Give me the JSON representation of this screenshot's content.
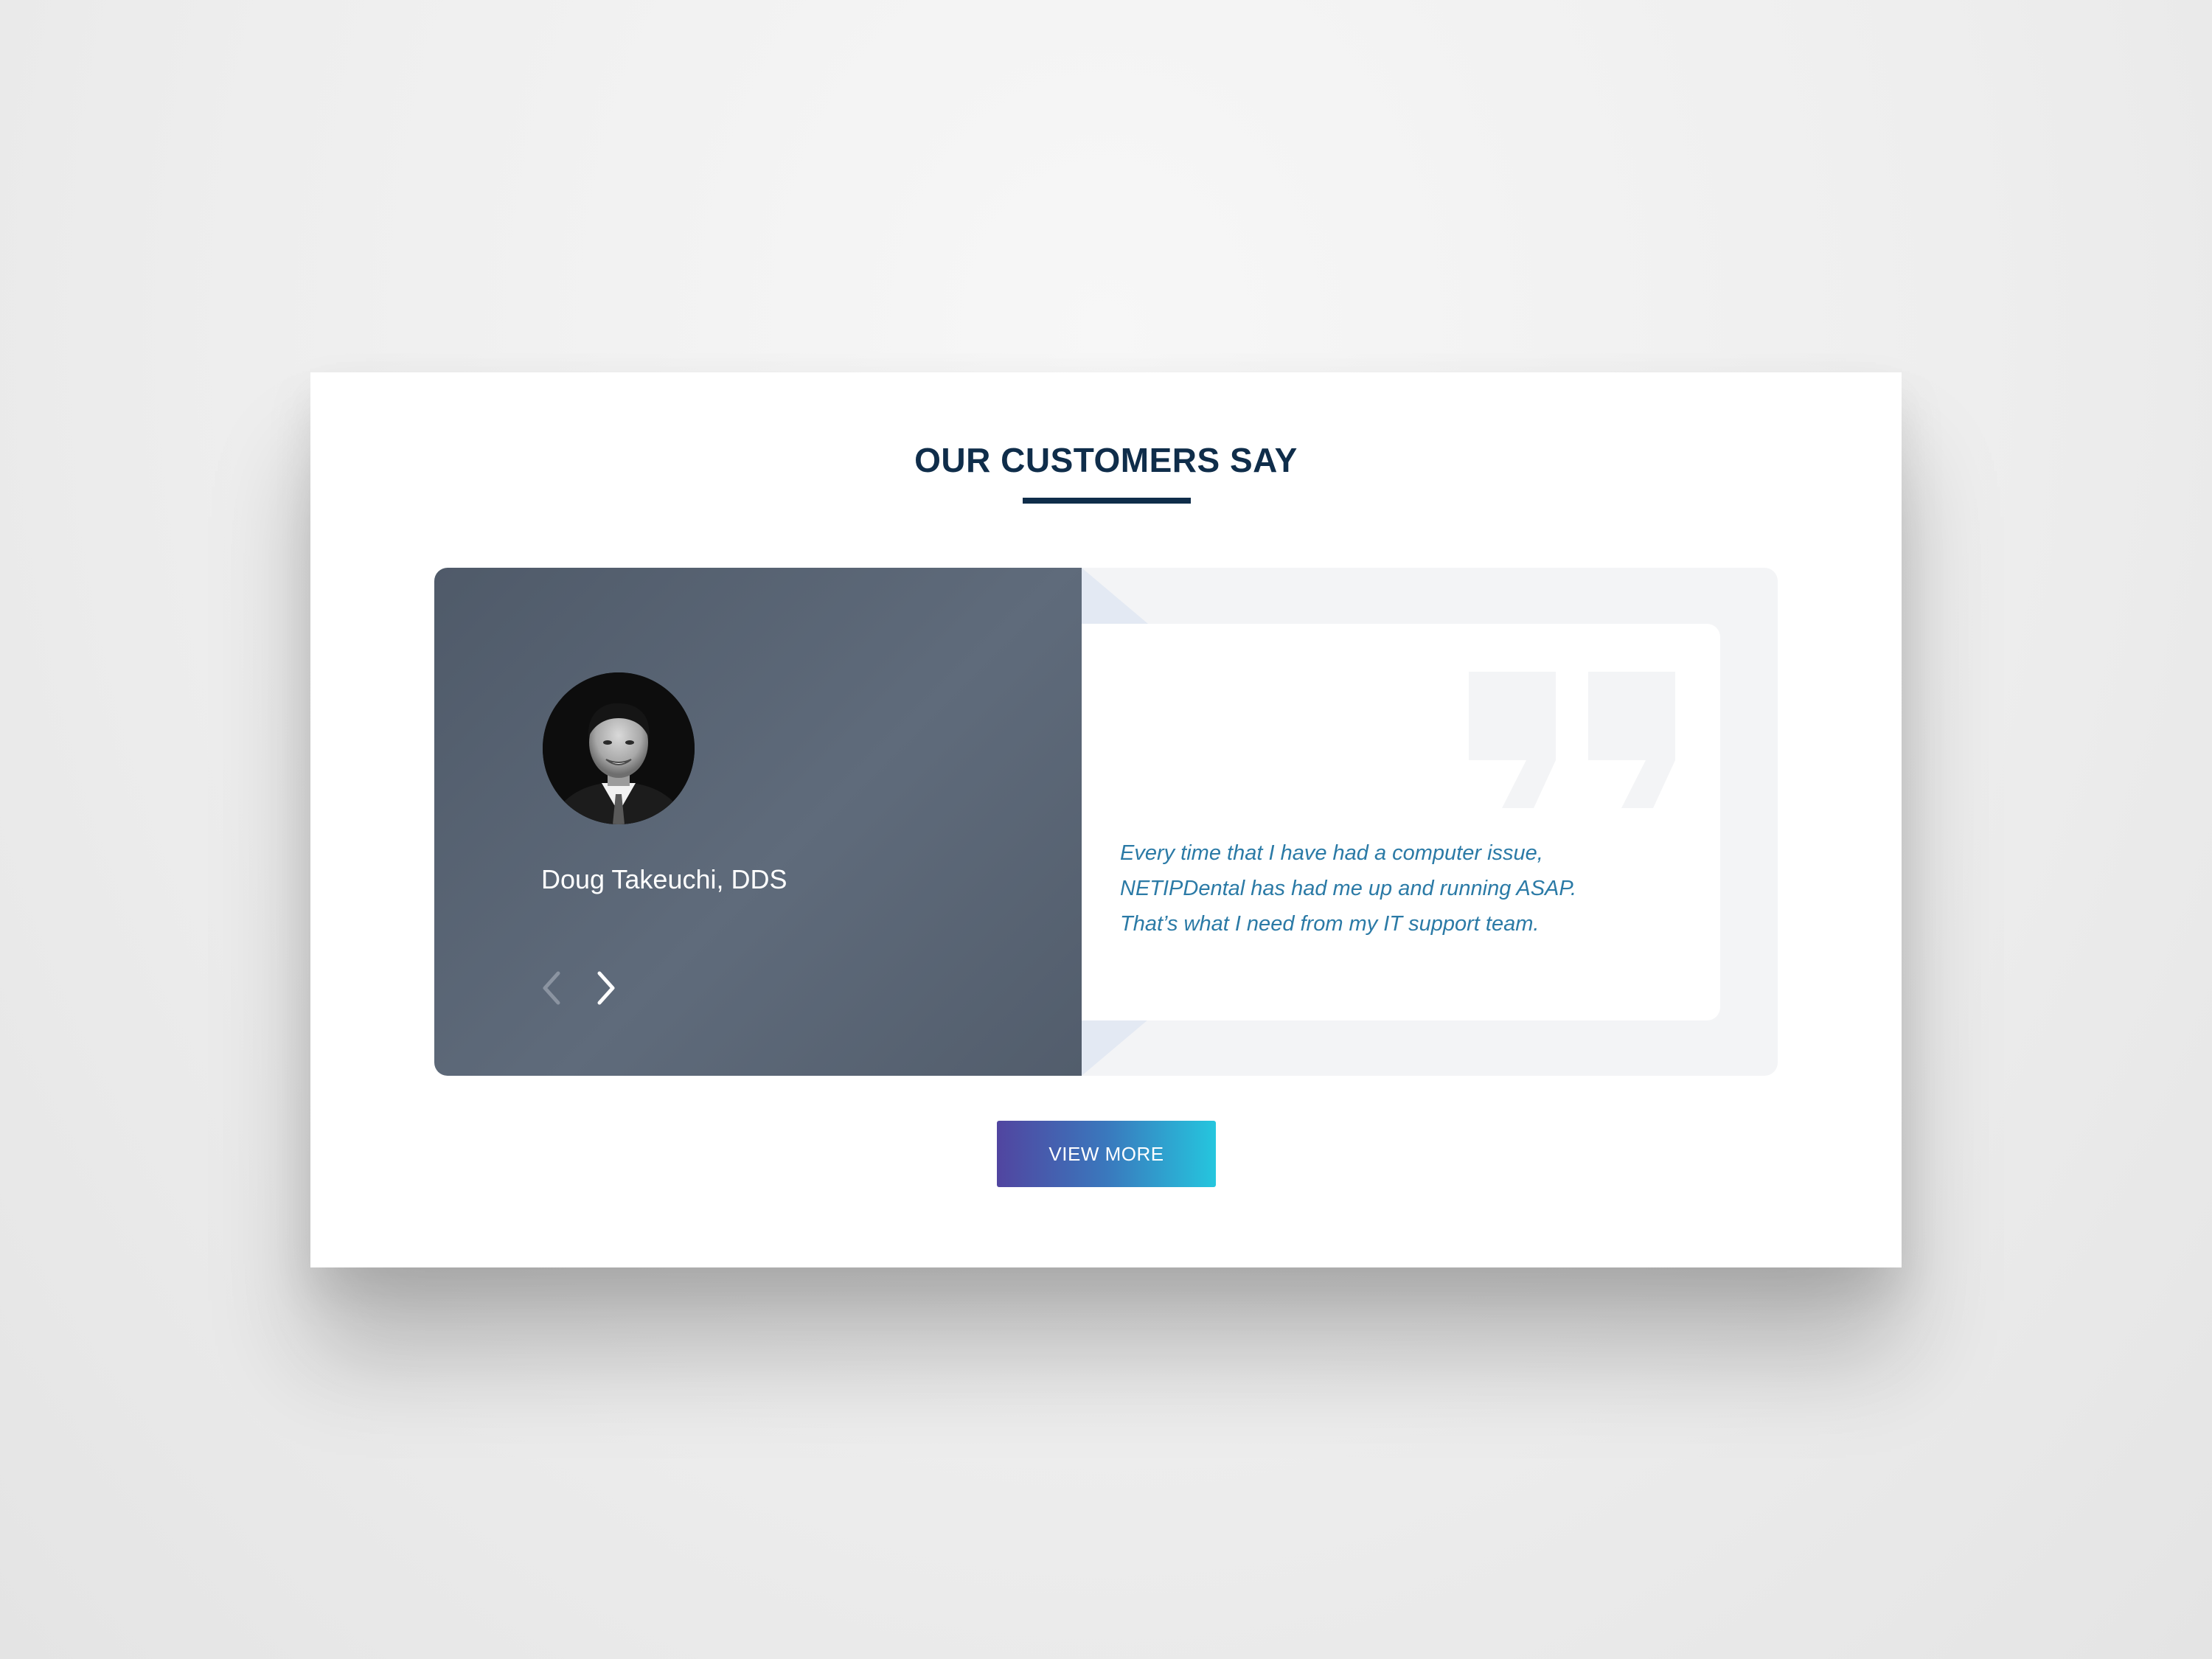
{
  "section": {
    "title": "OUR CUSTOMERS SAY"
  },
  "testimonial": {
    "client_name": "Doug Takeuchi, DDS",
    "avatar_icon": "person-avatar-icon",
    "quote_lines": [
      "Every time that I have had a computer issue,",
      "NETIPDental has had me up and running ASAP.",
      "That’s what I need from my IT support team."
    ]
  },
  "navigation": {
    "prev_icon": "chevron-left-icon",
    "next_icon": "chevron-right-icon"
  },
  "actions": {
    "view_more_label": "VIEW MORE"
  },
  "colors": {
    "title": "#0f2d4a",
    "quote_text": "#2b7aa6",
    "panel": "#566171",
    "button_gradient_start": "#5145a0",
    "button_gradient_end": "#25c6de"
  }
}
